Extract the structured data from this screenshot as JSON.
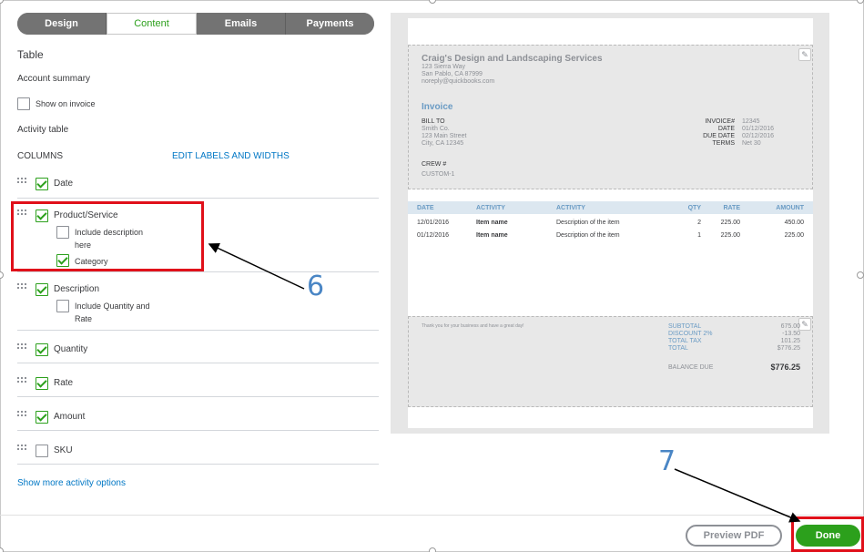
{
  "tabs": [
    {
      "label": "Design",
      "active": false
    },
    {
      "label": "Content",
      "active": true
    },
    {
      "label": "Emails",
      "active": false
    },
    {
      "label": "Payments",
      "active": false
    }
  ],
  "left": {
    "table_heading": "Table",
    "account_summary": "Account summary",
    "show_on_invoice": "Show on invoice",
    "activity_table": "Activity table",
    "columns_label": "COLUMNS",
    "edit_labels_link": "EDIT LABELS AND WIDTHS",
    "columns": [
      {
        "label": "Date",
        "checked": true
      },
      {
        "label": "Product/Service",
        "checked": true
      },
      {
        "label": "Description",
        "checked": true
      },
      {
        "label": "Quantity",
        "checked": true
      },
      {
        "label": "Rate",
        "checked": true
      },
      {
        "label": "Amount",
        "checked": true
      },
      {
        "label": "SKU",
        "checked": false
      }
    ],
    "product_sub": {
      "include_description_line1": "Include description",
      "include_description_line2": "here",
      "category": "Category"
    },
    "description_sub": {
      "include_qty_line1": "Include Quantity and",
      "include_qty_line2": "Rate"
    },
    "show_more_link": "Show more activity options"
  },
  "preview": {
    "company_name": "Craig's Design and Landscaping Services",
    "address1": "123 Sierra Way",
    "address2": "San Pablo, CA 87999",
    "email": "noreply@quickbooks.com",
    "invoice_title": "Invoice",
    "bill_to_label": "BILL TO",
    "bill_to_name": "Smith Co.",
    "bill_to_street": "123 Main Street",
    "bill_to_city": "City, CA 12345",
    "invoice_no_label": "INVOICE#",
    "invoice_no": "12345",
    "date_label": "DATE",
    "date_value": "01/12/2016",
    "due_label": "DUE DATE",
    "due_value": "02/12/2016",
    "terms_label": "TERMS",
    "terms_value": "Net 30",
    "crew_label": "CREW #",
    "custom_label": "CUSTOM-1",
    "table_headers": [
      "DATE",
      "ACTIVITY",
      "ACTIVITY",
      "QTY",
      "RATE",
      "AMOUNT"
    ],
    "rows": [
      [
        "12/01/2016",
        "Item name",
        "Description of the item",
        "2",
        "225.00",
        "450.00"
      ],
      [
        "01/12/2016",
        "Item name",
        "Description of the item",
        "1",
        "225.00",
        "225.00"
      ]
    ],
    "thanks": "Thank you for your business and have a great day!",
    "subtotal_label": "SUBTOTAL",
    "subtotal": "675.00",
    "discount_label": "DISCOUNT 2%",
    "discount": "-13.50",
    "tax_label": "TOTAL TAX",
    "tax": "101.25",
    "total_label": "TOTAL",
    "total": "$776.25",
    "balance_label": "BALANCE DUE",
    "balance": "$776.25"
  },
  "footer": {
    "preview_pdf": "Preview PDF",
    "done": "Done"
  },
  "annotations": {
    "callout_6": "6",
    "callout_7": "7"
  },
  "colors": {
    "accent_green": "#2ca01c",
    "link_blue": "#0077c5",
    "highlight_red": "#e0101a",
    "callout_blue": "#4a86c5"
  }
}
